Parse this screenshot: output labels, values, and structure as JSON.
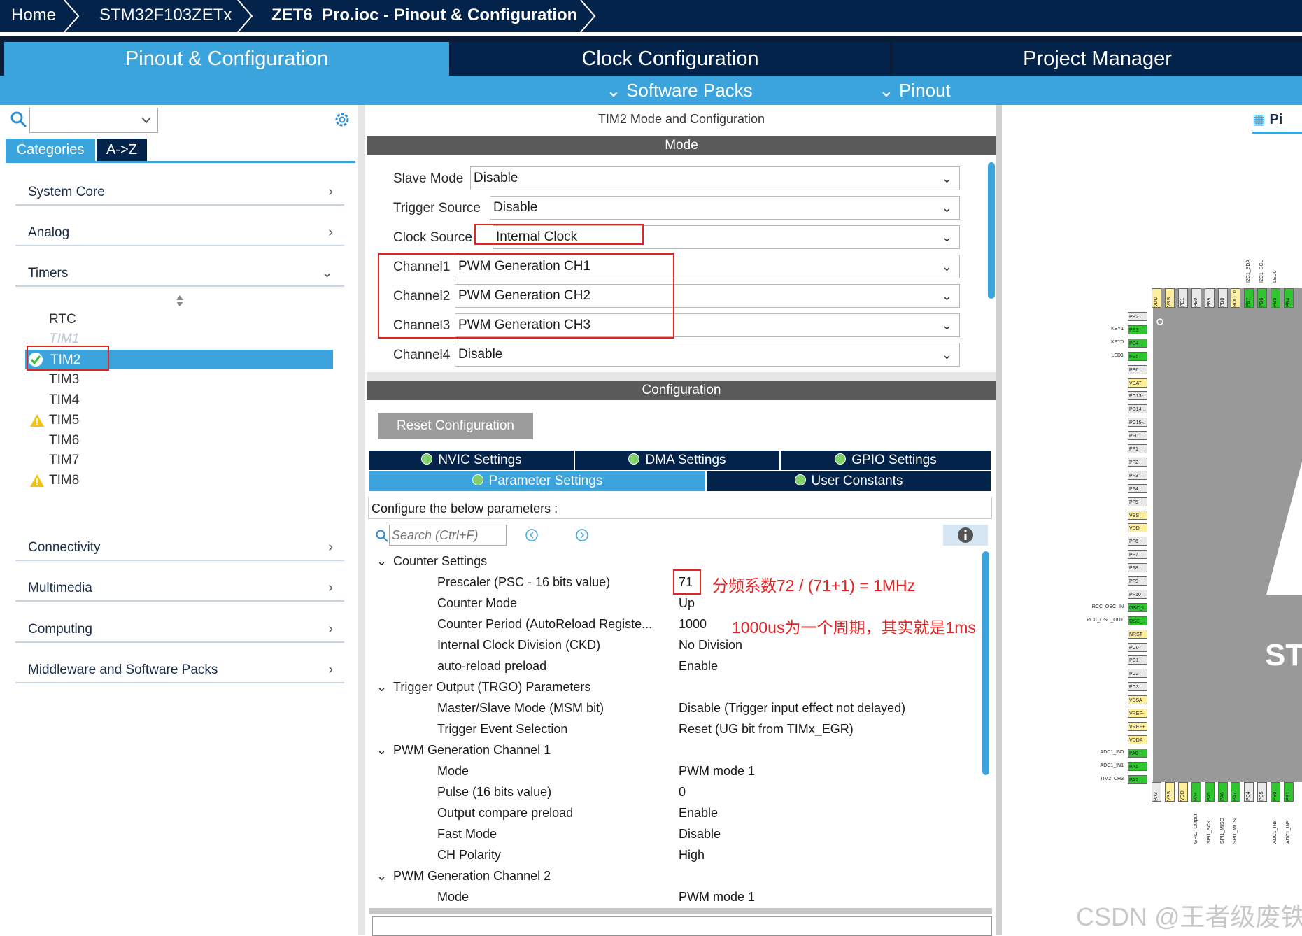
{
  "breadcrumb": {
    "home": "Home",
    "mcu": "STM32F103ZETx",
    "file": "ZET6_Pro.ioc - Pinout & Configuration"
  },
  "main_tabs": {
    "pinout": "Pinout & Configuration",
    "clock": "Clock Configuration",
    "project": "Project Manager"
  },
  "sub_menu": {
    "software_packs": "Software Packs",
    "pinout": "Pinout"
  },
  "left": {
    "tab_categories": "Categories",
    "tab_az": "A->Z",
    "categories": [
      {
        "label": "System Core"
      },
      {
        "label": "Analog"
      },
      {
        "label": "Timers"
      },
      {
        "label": "Connectivity"
      },
      {
        "label": "Multimedia"
      },
      {
        "label": "Computing"
      },
      {
        "label": "Middleware and Software Packs"
      }
    ],
    "timers": {
      "rtc": "RTC",
      "tim1": "TIM1",
      "tim2": "TIM2",
      "tim3": "TIM3",
      "tim4": "TIM4",
      "tim5": "TIM5",
      "tim6": "TIM6",
      "tim7": "TIM7",
      "tim8": "TIM8"
    }
  },
  "middle": {
    "title": "TIM2 Mode and Configuration",
    "mode_header": "Mode",
    "config_header": "Configuration",
    "mode_rows": [
      {
        "label": "Slave Mode",
        "value": "Disable"
      },
      {
        "label": "Trigger Source",
        "value": "Disable"
      },
      {
        "label": "Clock Source",
        "value": "Internal Clock"
      },
      {
        "label": "Channel1",
        "value": "PWM Generation CH1"
      },
      {
        "label": "Channel2",
        "value": "PWM Generation CH2"
      },
      {
        "label": "Channel3",
        "value": "PWM Generation CH3"
      },
      {
        "label": "Channel4",
        "value": "Disable"
      }
    ],
    "reset_button": "Reset Configuration",
    "settings_tabs": {
      "nvic": "NVIC Settings",
      "dma": "DMA Settings",
      "gpio": "GPIO Settings",
      "param": "Parameter Settings",
      "user": "User Constants"
    },
    "configure_text": "Configure the below parameters :",
    "search_placeholder": "Search (Ctrl+F)",
    "params": {
      "counter_settings": "Counter Settings",
      "prescaler_label": "Prescaler (PSC - 16 bits value)",
      "prescaler_value": "71",
      "counter_mode_label": "Counter Mode",
      "counter_mode_value": "Up",
      "counter_period_label": "Counter Period (AutoReload Registe...",
      "counter_period_value": "1000",
      "ckd_label": "Internal Clock Division (CKD)",
      "ckd_value": "No Division",
      "autoreload_label": "auto-reload preload",
      "autoreload_value": "Enable",
      "trgo_group": "Trigger Output (TRGO) Parameters",
      "msm_label": "Master/Slave Mode (MSM bit)",
      "msm_value": "Disable (Trigger input effect not delayed)",
      "tes_label": "Trigger Event Selection",
      "tes_value": "Reset (UG bit from TIMx_EGR)",
      "pwm1_group": "PWM Generation Channel 1",
      "mode_label": "Mode",
      "mode_value": "PWM mode 1",
      "pulse_label": "Pulse (16 bits value)",
      "pulse_value": "0",
      "ocp_label": "Output compare preload",
      "ocp_value": "Enable",
      "fast_label": "Fast Mode",
      "fast_value": "Disable",
      "pol_label": "CH Polarity",
      "pol_value": "High",
      "pwm2_group": "PWM Generation Channel 2",
      "mode2_label": "Mode",
      "mode2_value": "PWM mode 1"
    },
    "annotations": {
      "prescaler_note": "分频系数72 / (71+1) = 1MHz",
      "period_note": "1000us为一个周期，其实就是1ms"
    }
  },
  "right": {
    "tab_label": "Pi",
    "chip_text": "ST",
    "left_pins": [
      "PE2",
      "PE3",
      "PE4",
      "PE5",
      "PE6",
      "VBAT",
      "PC13-..",
      "PC14-..",
      "PC15-..",
      "PF0",
      "PF1",
      "PF2",
      "PF3",
      "PF4",
      "PF5",
      "VSS",
      "VDD",
      "PF6",
      "PF7",
      "PF8",
      "PF9",
      "PF10",
      "OSC_I..",
      "OSC_..",
      "NRST",
      "PC0",
      "PC1",
      "PC2",
      "PC3",
      "VSSA",
      "VREF-",
      "VREF+",
      "VDDA",
      "PA0-W..",
      "PA1",
      "PA2"
    ],
    "left_pin_labels": {
      "PE3": "KEY1",
      "PE4": "KEY0",
      "PE5": "LED1",
      "OSC_I..": "RCC_OSC_IN",
      "OSC_..": "RCC_OSC_OUT",
      "PA0-W..": "ADC1_IN0",
      "PA1": "ADC1_IN1",
      "PA2": "TIM2_CH3"
    },
    "top_pins": [
      "VDD",
      "VSS",
      "PE1",
      "PE0",
      "PB9",
      "PB8",
      "BOOT0",
      "PB7",
      "PB6",
      "PB5",
      "PB4"
    ],
    "top_pin_labels": {
      "PB7": "I2C1_SDA",
      "PB6": "I2C1_SCL",
      "PB5": "LED0"
    },
    "bottom_pins": [
      "PA3",
      "VSS",
      "VDD",
      "PA4",
      "PA5",
      "PA6",
      "PA7",
      "PC4",
      "PC5",
      "PB0",
      "PB1"
    ],
    "bottom_pin_labels": {
      "PA4": "GPIO_Output",
      "PA5": "SPI1_SCK",
      "PA6": "SPI1_MISO",
      "PA7": "SPI1_MOSI",
      "PB0": "ADC1_IN8",
      "PB1": "ADC1_IN9"
    }
  },
  "watermark": "CSDN @王者级废铁",
  "colors": {
    "navy": "#03234b",
    "blue": "#3ba4dc",
    "green": "#2fc52f",
    "yellow": "#ffef9a",
    "red": "#e52222"
  }
}
